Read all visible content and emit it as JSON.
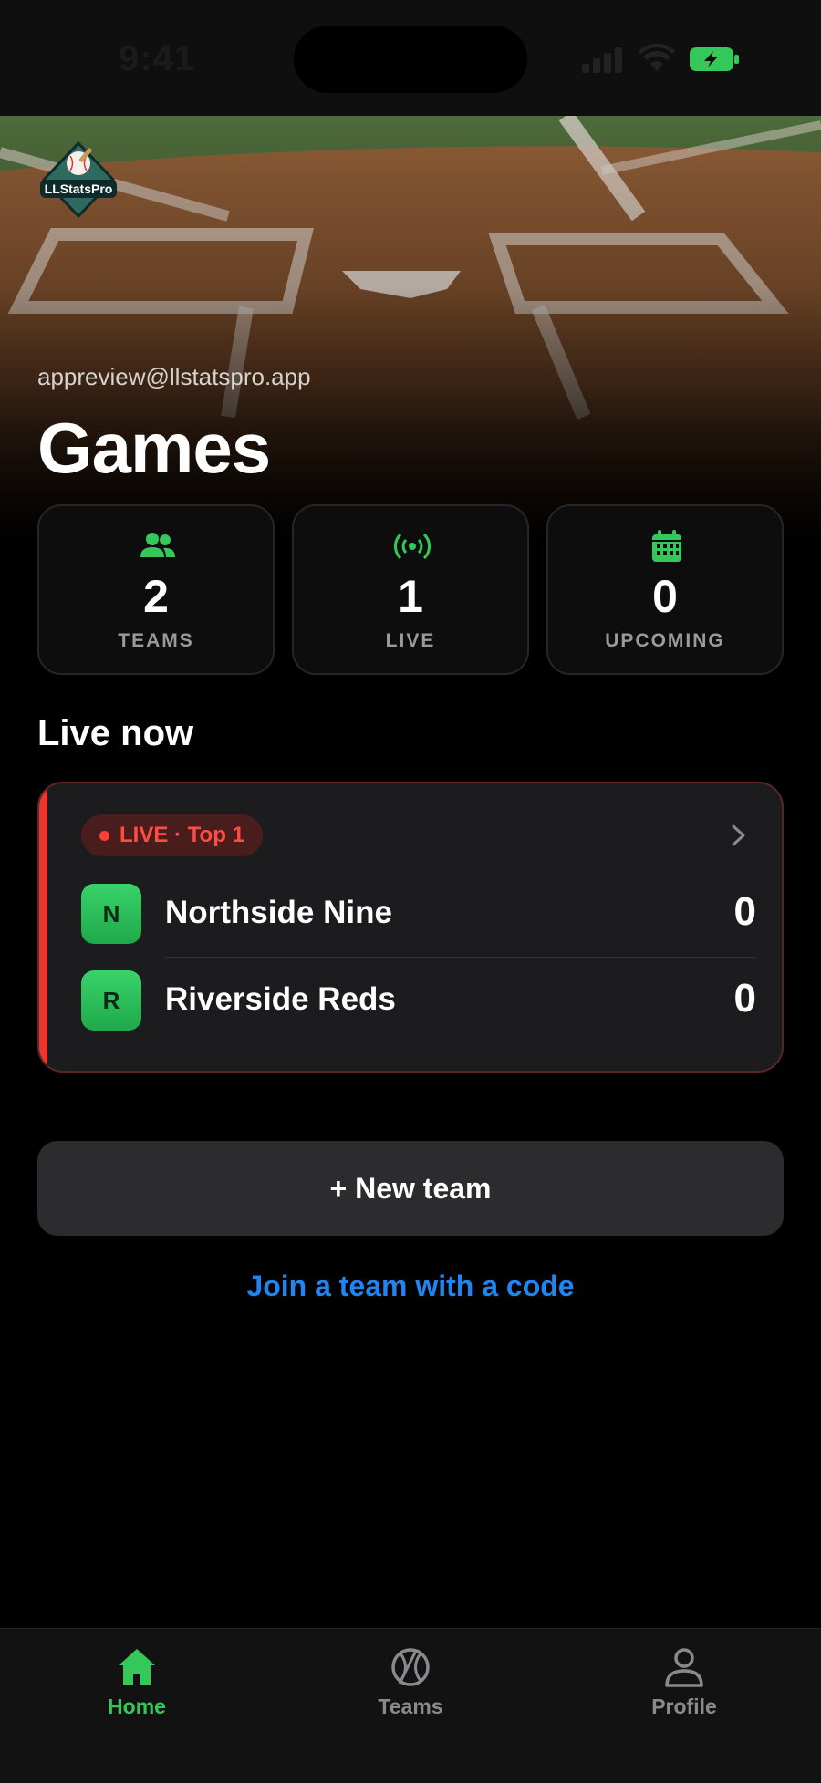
{
  "status_bar": {
    "time": "9:41"
  },
  "hero": {
    "logo_text": "LLStatsPro",
    "email": "appreview@llstatspro.app",
    "title": "Games"
  },
  "stats": [
    {
      "icon": "people-icon",
      "value": "2",
      "label": "TEAMS"
    },
    {
      "icon": "broadcast-icon",
      "value": "1",
      "label": "LIVE"
    },
    {
      "icon": "calendar-icon",
      "value": "0",
      "label": "UPCOMING"
    }
  ],
  "live_section": {
    "title": "Live now",
    "game": {
      "badge": "LIVE · Top 1",
      "teams": [
        {
          "initial": "N",
          "name": "Northside Nine",
          "score": "0"
        },
        {
          "initial": "R",
          "name": "Riverside Reds",
          "score": "0"
        }
      ]
    }
  },
  "actions": {
    "new_team": "+ New team",
    "join_team": "Join a team with a code"
  },
  "tab_bar": {
    "tabs": [
      {
        "label": "Home",
        "icon": "home-icon",
        "active": true
      },
      {
        "label": "Teams",
        "icon": "baseball-icon",
        "active": false
      },
      {
        "label": "Profile",
        "icon": "person-icon",
        "active": false
      }
    ]
  },
  "colors": {
    "accent_green": "#34c759",
    "live_red": "#ff4036",
    "link_blue": "#1e85f2"
  }
}
